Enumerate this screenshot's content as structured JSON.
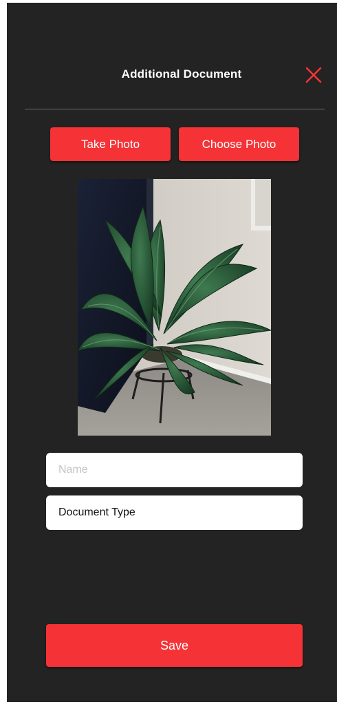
{
  "header": {
    "title": "Additional Document",
    "close_icon": "close-icon",
    "close_color": "#f53336"
  },
  "actions": {
    "take_photo_label": "Take Photo",
    "choose_photo_label": "Choose Photo"
  },
  "preview": {
    "subject": "potted plant photo"
  },
  "form": {
    "name_placeholder": "Name",
    "name_value": "",
    "document_type_label": "Document Type"
  },
  "footer": {
    "save_label": "Save"
  },
  "colors": {
    "accent": "#f53336",
    "background": "#232323",
    "field_background": "#ffffff"
  }
}
